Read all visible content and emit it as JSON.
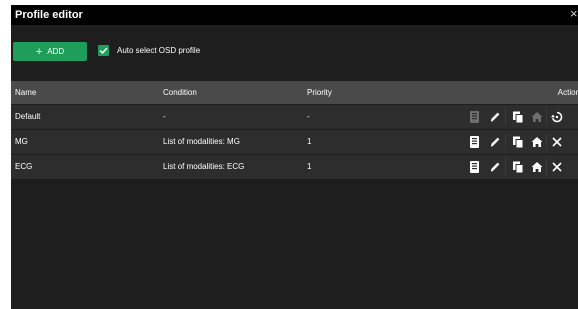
{
  "window": {
    "title": "Profile editor",
    "close_glyph": "×"
  },
  "toolbar": {
    "add_label": "ADD",
    "add_icon": "plus-icon",
    "checkbox_label": "Auto select OSD profile",
    "checkbox_checked": true
  },
  "table": {
    "headers": {
      "name": "Name",
      "condition": "Condition",
      "priority": "Priority",
      "actions": "Actions"
    },
    "rows": [
      {
        "name": "Default",
        "condition": "-",
        "priority": "-",
        "actions": {
          "osd": "disabled",
          "edit": "enabled",
          "duplicate": "enabled",
          "home": "disabled",
          "last": "reset"
        }
      },
      {
        "name": "MG",
        "condition": "List of modalities: MG",
        "priority": "1",
        "actions": {
          "osd": "enabled",
          "edit": "enabled",
          "duplicate": "enabled",
          "home": "enabled",
          "last": "delete"
        }
      },
      {
        "name": "ECG",
        "condition": "List of modalities: ECG",
        "priority": "1",
        "actions": {
          "osd": "enabled",
          "edit": "enabled",
          "duplicate": "enabled",
          "home": "enabled",
          "last": "delete"
        }
      }
    ]
  },
  "colors": {
    "accent_green": "#1f9d5a",
    "title_bar": "#000000",
    "panel": "#1e1e1e",
    "header_row": "#4a4a4a",
    "data_row": "#2d2d2d",
    "icon_enabled": "#ffffff",
    "icon_disabled": "#6f6f6f"
  }
}
